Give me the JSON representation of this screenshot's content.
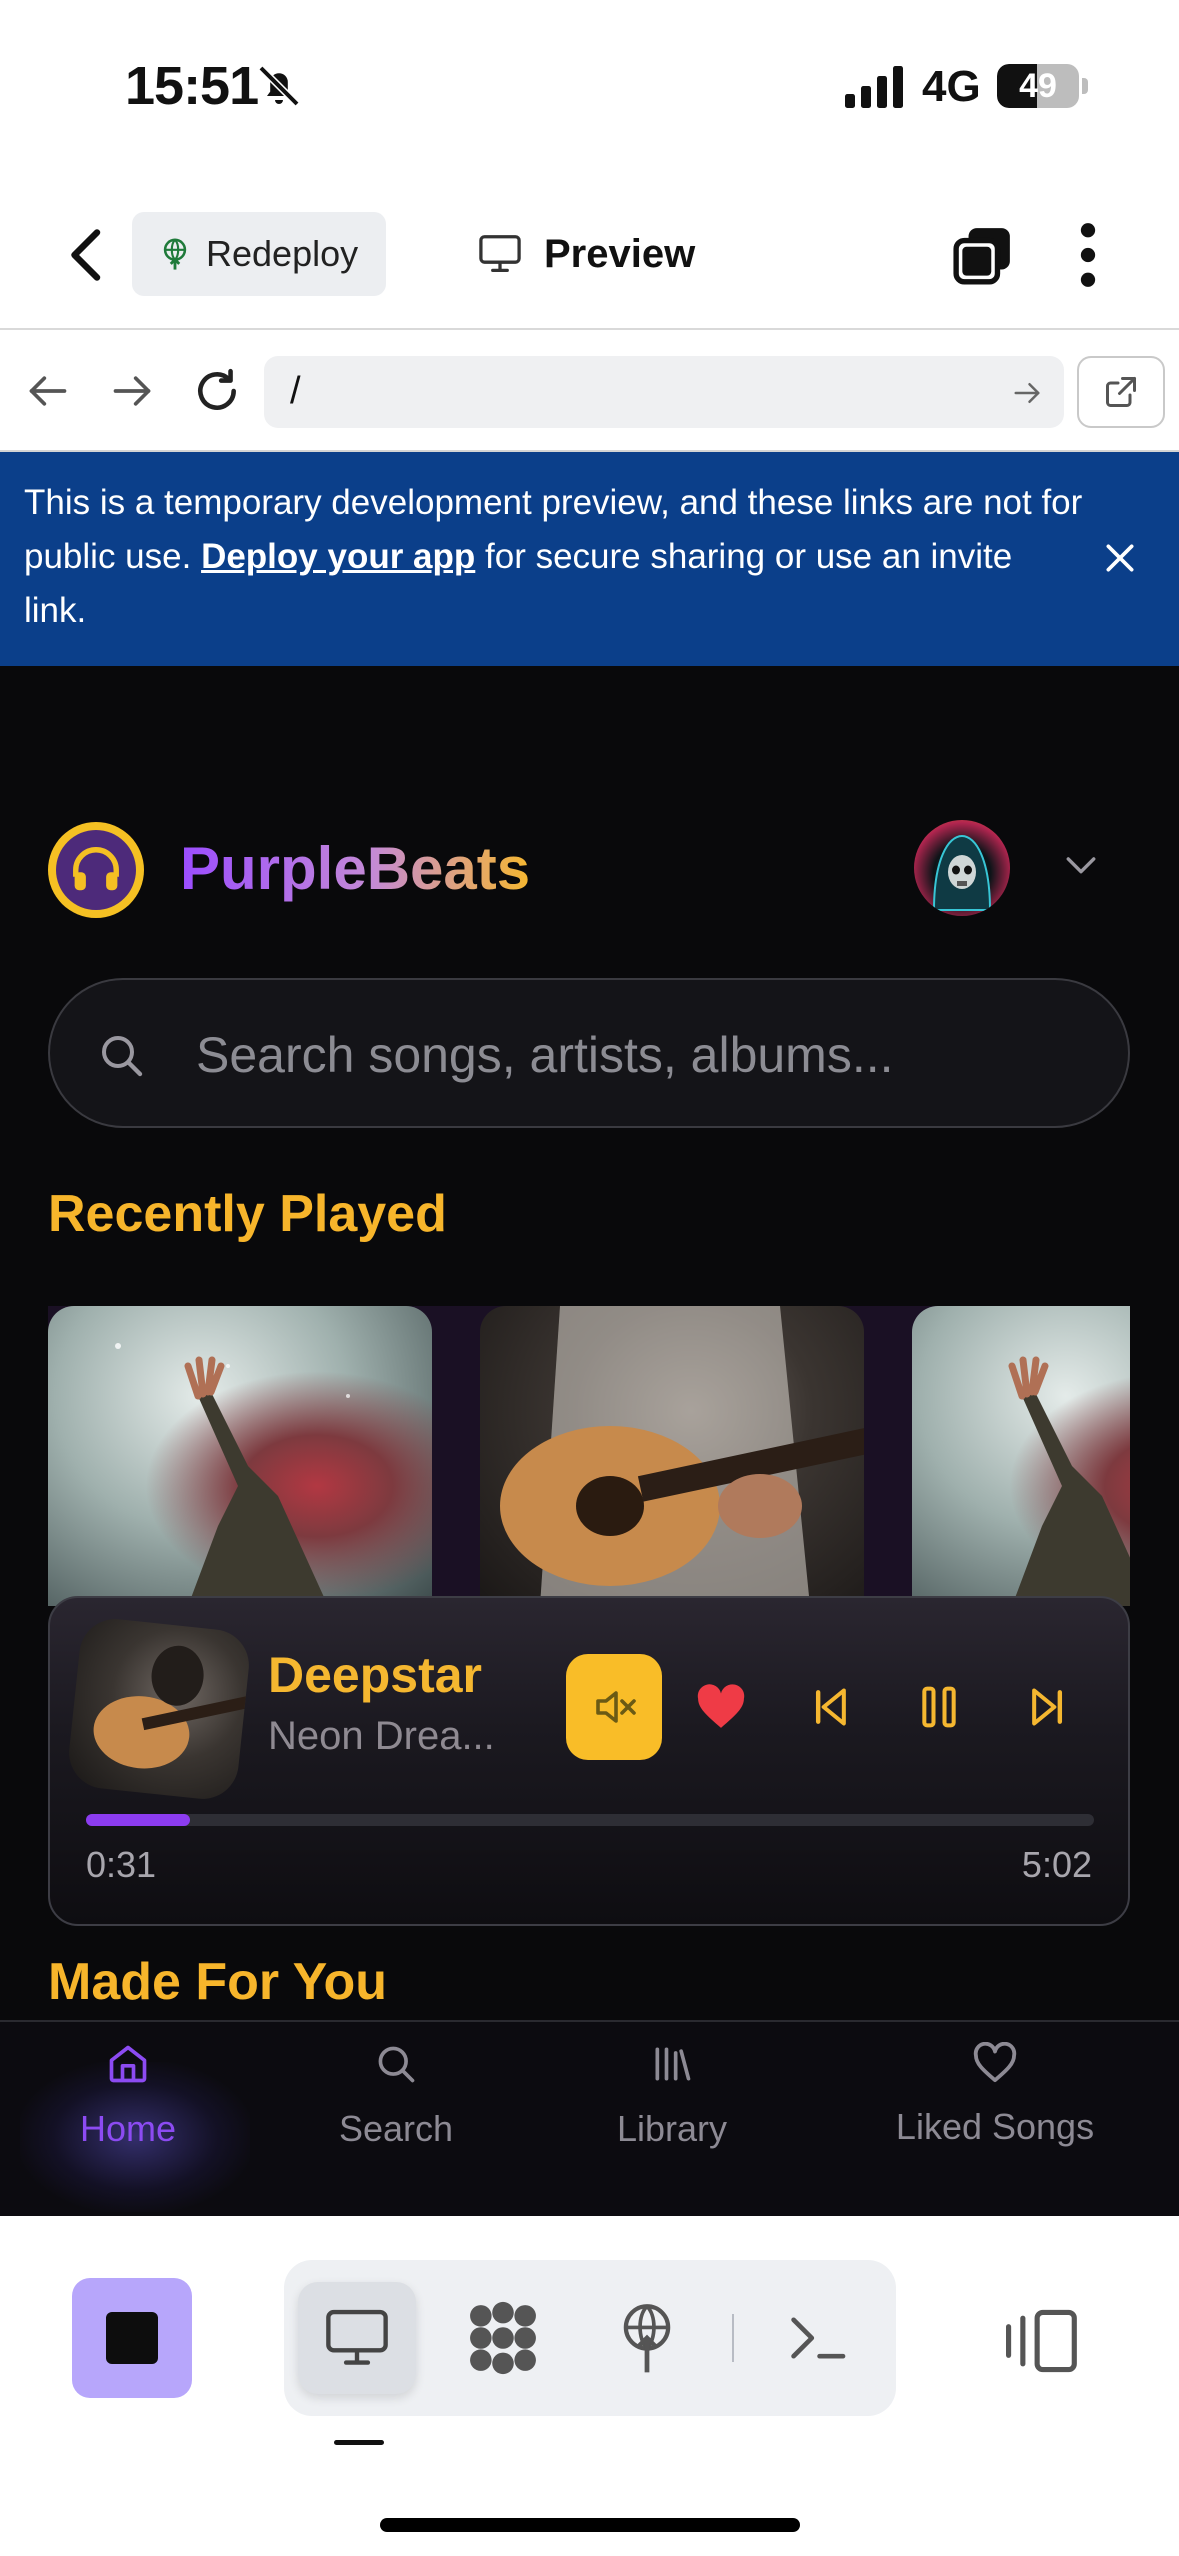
{
  "status_bar": {
    "time": "15:51",
    "network": "4G",
    "battery_level": "49",
    "battery_fraction": 0.49
  },
  "top_bar": {
    "redeploy_label": "Redeploy",
    "preview_label": "Preview"
  },
  "url_bar": {
    "path": "/"
  },
  "banner": {
    "text_before": "This is a temporary development preview, and these links are not for public use. ",
    "link_text": "Deploy your app",
    "text_after": " for secure sharing or use an invite link."
  },
  "app": {
    "brand": "PurpleBeats",
    "search_placeholder": "Search songs, artists, albums...",
    "recently_played_title": "Recently Played",
    "made_for_you_title": "Made For You",
    "now_playing": {
      "title": "Deepstar",
      "artist": "Neon Drea...",
      "current_time": "0:31",
      "total_time": "5:02",
      "progress_fraction": 0.103
    },
    "nav": [
      {
        "label": "Home",
        "icon": "home-icon",
        "active": true
      },
      {
        "label": "Search",
        "icon": "search-icon",
        "active": false
      },
      {
        "label": "Library",
        "icon": "library-icon",
        "active": false
      },
      {
        "label": "Liked Songs",
        "icon": "heart-icon",
        "active": false
      }
    ]
  },
  "colors": {
    "accent_purple": "#8c4bf2",
    "accent_gold": "#f7b52b",
    "banner_blue": "#0b3f8a",
    "stop_button": "#b7a6fb",
    "heart_red": "#ef3b46"
  }
}
